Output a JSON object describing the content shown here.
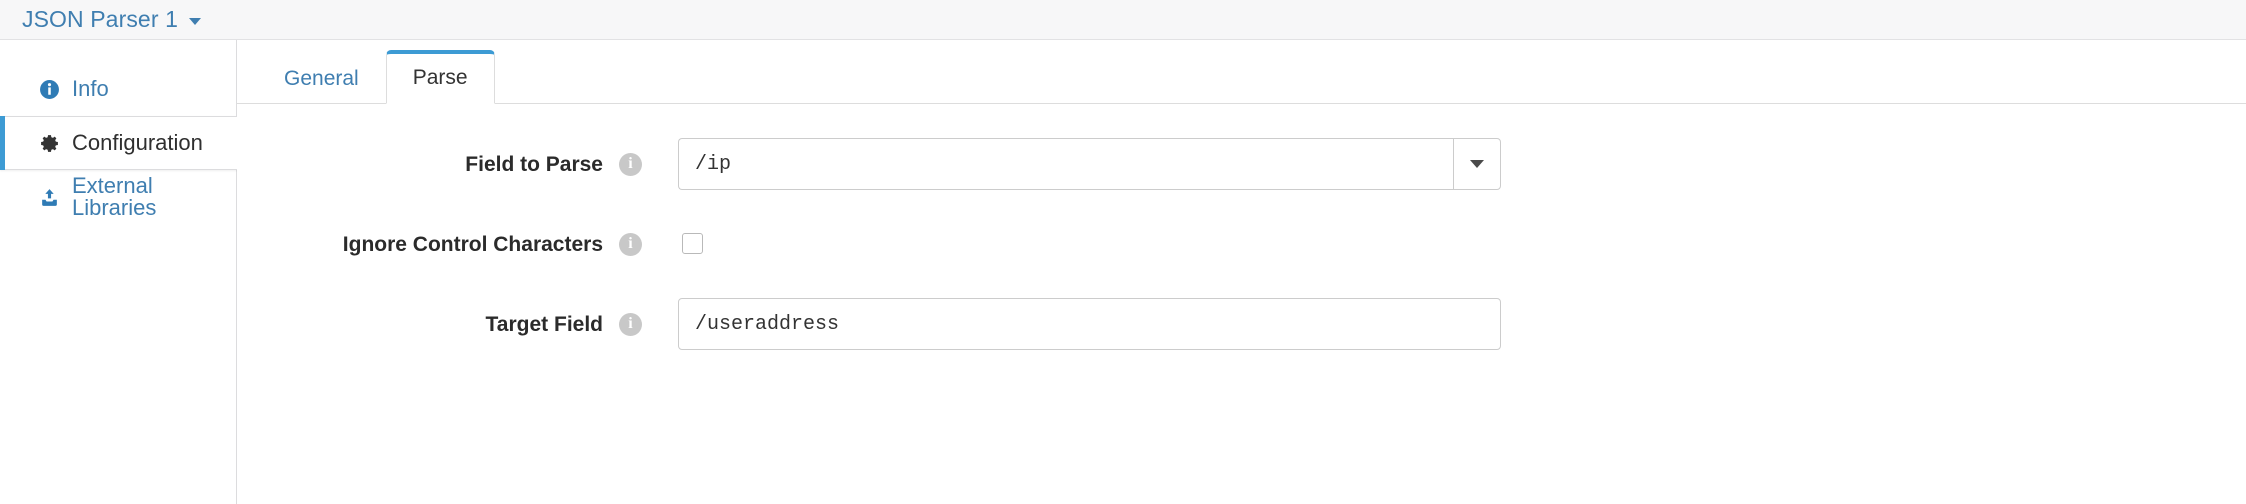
{
  "topbar": {
    "title": "JSON Parser 1",
    "caret_icon": "chevron-down-icon"
  },
  "sidebar": {
    "items": [
      {
        "label": "Info",
        "icon": "info-circle-icon",
        "active": false
      },
      {
        "label": "Configuration",
        "icon": "gear-icon",
        "active": true
      },
      {
        "label": "External Libraries",
        "icon": "upload-icon",
        "active": false
      }
    ]
  },
  "tabs": [
    {
      "label": "General",
      "active": false
    },
    {
      "label": "Parse",
      "active": true
    }
  ],
  "form": {
    "rows": [
      {
        "label": "Field to Parse",
        "info_icon": "info-icon",
        "control": "combobox",
        "value": "/ip",
        "placeholder": "",
        "dropdown_icon": "caret-down-icon"
      },
      {
        "label": "Ignore Control Characters",
        "info_icon": "info-icon",
        "control": "checkbox",
        "checked": false
      },
      {
        "label": "Target Field",
        "info_icon": "info-icon",
        "control": "text",
        "value": "/useraddress",
        "placeholder": ""
      }
    ]
  },
  "colors": {
    "link_blue": "#3f7eb0",
    "accent_blue": "#3d9bd4",
    "topbar_bg": "#f7f7f8",
    "border": "#dcdcde",
    "info_icon_grey": "#c8c8c8"
  }
}
